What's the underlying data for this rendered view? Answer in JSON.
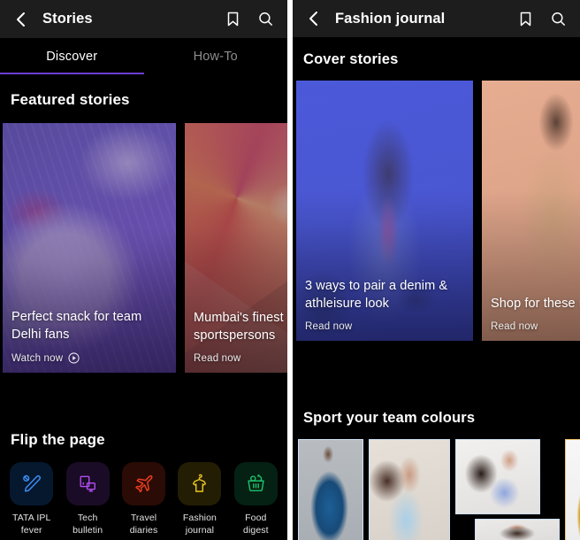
{
  "left_panel": {
    "appbar": {
      "title": "Stories",
      "back_icon": "chevron-left-icon",
      "bookmark_icon": "bookmark-icon",
      "search_icon": "search-icon"
    },
    "tabs": {
      "active_index": 0,
      "indicator_color": "#6c3ed6",
      "items": [
        {
          "label": "Discover"
        },
        {
          "label": "How-To"
        }
      ]
    },
    "featured": {
      "section_title": "Featured stories",
      "cards": [
        {
          "title": "Perfect snack for team Delhi fans",
          "cta": "Watch now",
          "cta_icon": "play-circle-icon",
          "media": "food-photo-purple-tint"
        },
        {
          "title": "Mumbai's finest sportspersons",
          "cta": "Read now",
          "cta_icon": "",
          "media": "sports-illustration-orange"
        }
      ]
    },
    "flip": {
      "section_title": "Flip the page",
      "chips": [
        {
          "label": "TATA IPL fever",
          "icon": "cricket-bat-ball-icon",
          "accent": "#3d8ef5",
          "tile_bg": "#06182e"
        },
        {
          "label": "Tech bulletin",
          "icon": "desktop-monitor-icon",
          "accent": "#b24df0",
          "tile_bg": "#1a0c26"
        },
        {
          "label": "Travel diaries",
          "icon": "airplane-icon",
          "accent": "#f03e1e",
          "tile_bg": "#2a0b05"
        },
        {
          "label": "Fashion journal",
          "icon": "tshirt-hanger-icon",
          "accent": "#e8c520",
          "tile_bg": "#231d03"
        },
        {
          "label": "Food digest",
          "icon": "shopping-basket-icon",
          "accent": "#1fbf6a",
          "tile_bg": "#042113"
        }
      ]
    }
  },
  "right_panel": {
    "appbar": {
      "title": "Fashion journal",
      "back_icon": "chevron-left-icon",
      "bookmark_icon": "bookmark-icon",
      "search_icon": "search-icon"
    },
    "cover": {
      "section_title": "Cover stories",
      "cards": [
        {
          "title": "3 ways to pair a denim & athleisure look",
          "cta": "Read now",
          "media": "man-denim-jacket-blue-tint"
        },
        {
          "title": "Shop for these materials",
          "cta": "Read now",
          "media": "models-tan-outfits"
        }
      ]
    },
    "sport": {
      "section_title": "Sport your team colours",
      "products": [
        {
          "media": "woman-blue-kurta"
        },
        {
          "media": "woman-light-blue-lace-top"
        },
        {
          "media": "woman-printed-blue-shirt"
        },
        {
          "media": "woman-portrait-dark-hair"
        },
        {
          "media": "man-yellow-tshirt"
        }
      ]
    }
  }
}
